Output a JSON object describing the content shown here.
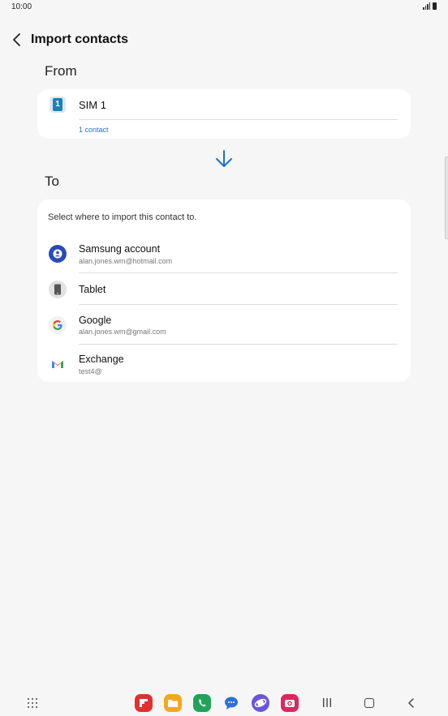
{
  "status_bar": {
    "time": "10:00"
  },
  "header": {
    "title": "Import contacts"
  },
  "from": {
    "section_title": "From",
    "source_icon_label": "1",
    "source_name": "SIM 1",
    "contact_count": "1 contact"
  },
  "to": {
    "section_title": "To",
    "hint": "Select where to import this contact to.",
    "accounts": [
      {
        "name": "Samsung account",
        "email": "alan.jones.wm@hotmail.com",
        "icon": "samsung-account-icon"
      },
      {
        "name": "Tablet",
        "email": "",
        "icon": "tablet-icon"
      },
      {
        "name": "Google",
        "email": "alan.jones.wm@gmail.com",
        "icon": "google-icon"
      },
      {
        "name": "Exchange",
        "email": "test4@",
        "icon": "gmail-icon"
      }
    ]
  },
  "dock": {
    "apps": [
      "flipboard-app-icon",
      "my-files-app-icon",
      "phone-app-icon",
      "messages-app-icon",
      "internet-app-icon",
      "camera-app-icon"
    ]
  },
  "colors": {
    "accent": "#1a73c8",
    "background": "#f6f6f6",
    "card": "#ffffff"
  }
}
